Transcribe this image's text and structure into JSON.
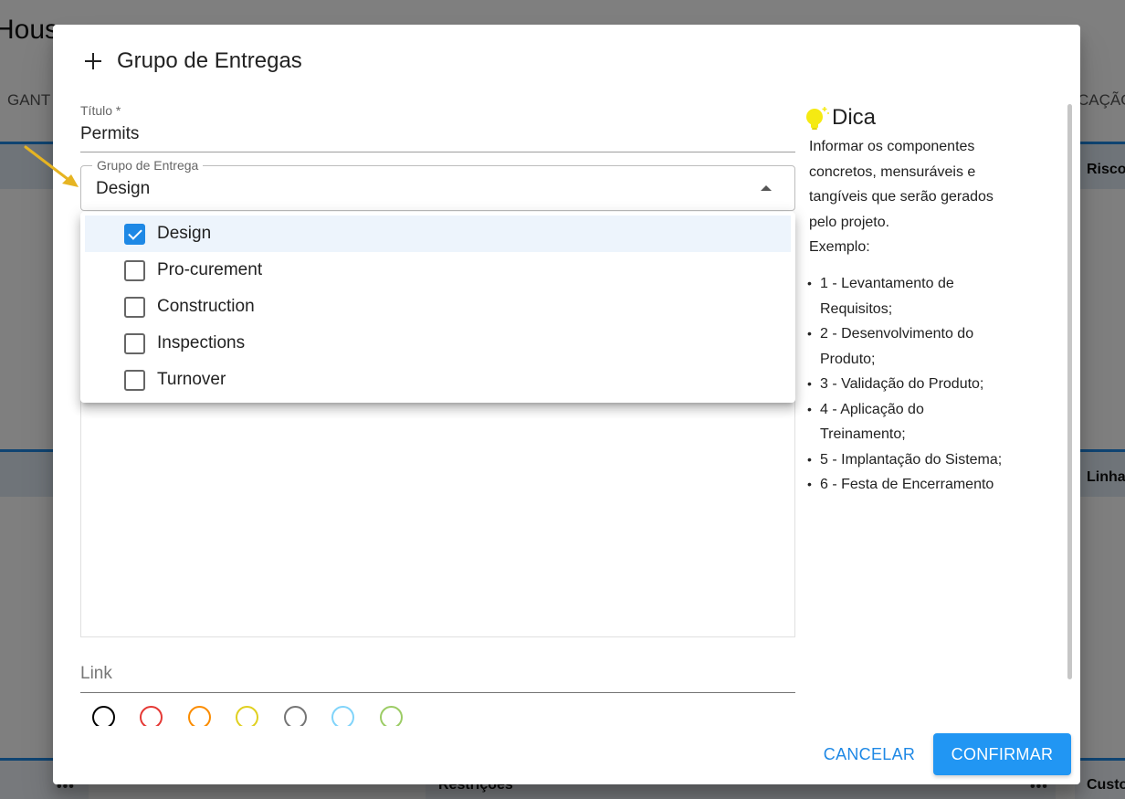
{
  "background": {
    "title": "Hous",
    "tab_left": "GANT",
    "tab_right": "CAÇÃO",
    "panel_risks": "Risco",
    "panel_lines": "Linha",
    "panel_restrictions": "Restrições",
    "panel_costs": "Custo"
  },
  "dialog": {
    "title": "Grupo de Entregas",
    "title_field": {
      "label": "Título *",
      "value": "Permits"
    },
    "group_field": {
      "label": "Grupo de Entrega",
      "value": "Design",
      "options": [
        {
          "label": "Design",
          "checked": true
        },
        {
          "label": "Pro-curement",
          "checked": false
        },
        {
          "label": "Construction",
          "checked": false
        },
        {
          "label": "Inspections",
          "checked": false
        },
        {
          "label": "Turnover",
          "checked": false
        }
      ]
    },
    "link_field": {
      "placeholder": "Link"
    },
    "colors": [
      "#000000",
      "#e53935",
      "#fb8c00",
      "#e0d020",
      "#757575",
      "#81d4fa",
      "#9ccc65"
    ],
    "tip": {
      "title": "Dica",
      "text_lines": [
        "Informar os componentes",
        "concretos, mensuráveis e",
        "tangíveis que serão gerados",
        "pelo projeto.",
        "Exemplo:"
      ],
      "items": [
        [
          "1 - Levantamento de",
          "Requisitos;"
        ],
        [
          "2 - Desenvolvimento do",
          "Produto;"
        ],
        [
          "3 - Validação do Produto;"
        ],
        [
          "4 - Aplicação do",
          "Treinamento;"
        ],
        [
          "5 - Implantação do Sistema;"
        ],
        [
          "6 - Festa de Encerramento"
        ]
      ]
    },
    "actions": {
      "cancel": "CANCELAR",
      "confirm": "CONFIRMAR"
    }
  }
}
